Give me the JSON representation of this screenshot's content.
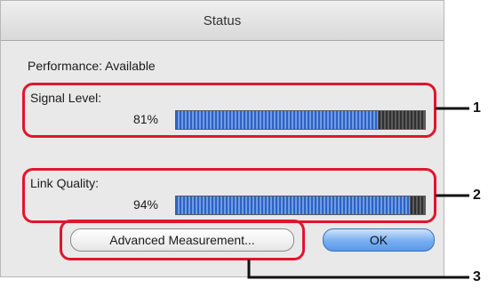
{
  "window": {
    "title": "Status"
  },
  "performance": {
    "text": "Performance: Available"
  },
  "signal": {
    "label": "Signal Level:",
    "percent_text": "81%",
    "level_fraction": 0.81
  },
  "link": {
    "label": "Link Quality:",
    "percent_text": "94%",
    "level_fraction": 0.94
  },
  "buttons": {
    "advanced_label": "Advanced Measurement...",
    "ok_label": "OK"
  },
  "callouts": [
    "1",
    "2",
    "3"
  ],
  "colors": {
    "callout_border": "#e0162b",
    "bar_fill": "#2f62c0",
    "ok_button": "#5a99ea"
  }
}
